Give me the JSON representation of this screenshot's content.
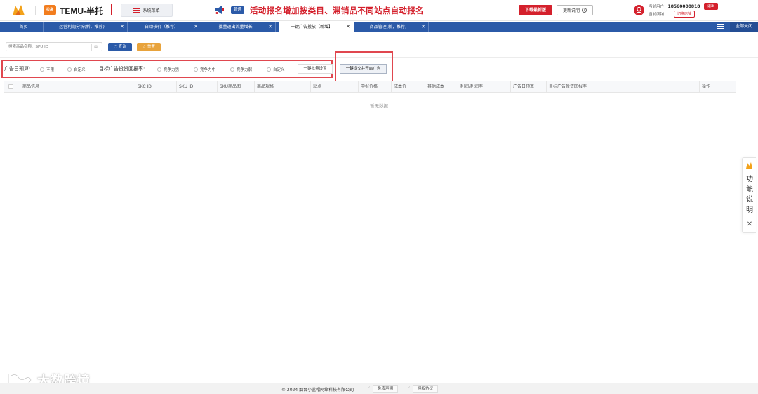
{
  "header": {
    "app_logo_icon": "orange-flame-logo-icon",
    "temu_badge": "拉高",
    "title": "TEMU-半托",
    "system_menu_label": "系统菜单",
    "notice_badge": "普通",
    "notice_text": "活动报名增加按类目、滞销品不同站点自动报名",
    "download_label": "下载最新版",
    "update_label": "更新说明",
    "current_user_label": "当前用户：",
    "current_user_value": "18560008818",
    "logout_label": "退出",
    "current_store_label": "当前店铺：",
    "switch_store_label": "切换店铺",
    "brand_red": "#d4202c",
    "brand_blue": "#2b5aa8"
  },
  "tabs": [
    {
      "label": "首页",
      "closable": false
    },
    {
      "label": "运营利润分析(新，推荐)",
      "closable": true
    },
    {
      "label": "自动核价（推荐）",
      "closable": true
    },
    {
      "label": "批量退出流量增长",
      "closable": true
    },
    {
      "label": "一键广告投放【新增】",
      "closable": true,
      "active": true
    },
    {
      "label": "商品管理(新，推荐)",
      "closable": true
    }
  ],
  "tabbar": {
    "close_all_label": "全部关闭"
  },
  "search": {
    "placeholder": "搜索商品名称、SPU ID",
    "query_label": "查询",
    "reset_label": "重置"
  },
  "ad_options": {
    "budget_label": "广告日预算:",
    "budget_options": [
      "不限",
      "自定义"
    ],
    "roi_label": "目标广告投资回报率:",
    "roi_options": [
      "竞争力强",
      "竞争力中",
      "竞争力弱",
      "自定义"
    ],
    "batch_settings_label": "一键批量设置",
    "submit_label": "一键提交并开启广告"
  },
  "table": {
    "columns": [
      "商品信息",
      "SKC ID",
      "SKU ID",
      "SKU商品图",
      "商品规格",
      "站点",
      "申报价格",
      "成本价",
      "其他成本",
      "利润/利润率",
      "广告日预算",
      "目标广告投资回报率",
      "操作"
    ],
    "empty_text": "暂无数据"
  },
  "help_tab": {
    "label": "功能说明",
    "close": "✕"
  },
  "footer": {
    "copyright": "© 2024 烟台小蓝帽网络科技有限公司",
    "disclaimer_label": "免责声明",
    "license_label": "授权协议"
  },
  "watermark": {
    "text": "大数跨境"
  }
}
